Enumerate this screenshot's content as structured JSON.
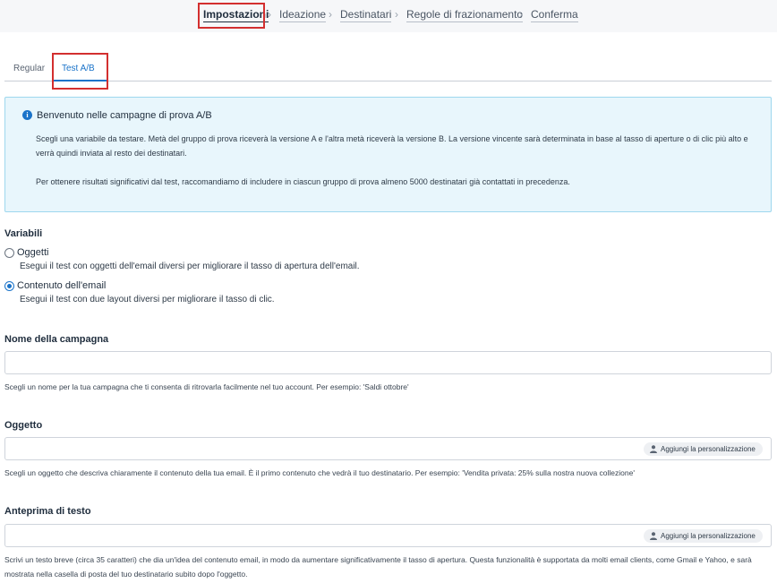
{
  "stepper": {
    "steps": [
      {
        "label": "Impostazioni",
        "active": true
      },
      {
        "label": "Ideazione",
        "active": false
      },
      {
        "label": "Destinatari",
        "active": false
      },
      {
        "label": "Regole di frazionamento",
        "active": false
      },
      {
        "label": "Conferma",
        "active": false
      }
    ]
  },
  "tabs": [
    {
      "label": "Regular",
      "active": false
    },
    {
      "label": "Test A/B",
      "active": true
    }
  ],
  "info": {
    "title": "Benvenuto nelle campagne di prova A/B",
    "paragraph1": "Scegli una variabile da testare. Metà del gruppo di prova riceverà la versione A e l'altra metà riceverà la versione B. La versione vincente sarà determinata in base al tasso di aperture o di clic più alto e verrà quindi inviata al resto dei destinatari.",
    "paragraph2": "Per ottenere risultati significativi dal test, raccomandiamo di includere in ciascun gruppo di prova almeno 5000 destinatari già contattati in precedenza."
  },
  "variables": {
    "title": "Variabili",
    "options": [
      {
        "label": "Oggetti",
        "description": "Esegui il test con oggetti dell'email diversi per migliorare il tasso di apertura dell'email.",
        "checked": false
      },
      {
        "label": "Contenuto dell'email",
        "description": "Esegui il test con due layout diversi per migliorare il tasso di clic.",
        "checked": true
      }
    ]
  },
  "campaign_name": {
    "label": "Nome della campagna",
    "value": "",
    "help": "Scegli un nome per la tua campagna che ti consenta di ritrovarla facilmente nel tuo account. Per esempio: 'Saldi ottobre'"
  },
  "subject": {
    "label": "Oggetto",
    "value": "",
    "button": "Aggiungi la personalizzazione",
    "help": "Scegli un oggetto che descriva chiaramente il contenuto della tua email. È il primo contenuto che vedrà il tuo destinatario. Per esempio: 'Vendita privata: 25% sulla nostra nuova collezione'"
  },
  "preview_text": {
    "label": "Anteprima di testo",
    "value": "",
    "button": "Aggiungi la personalizzazione",
    "help": "Scrivi un testo breve (circa 35 caratteri) che dia un'idea del contenuto email, in modo da aumentare significativamente il tasso di apertura. Questa funzionalità è supportata da molti email clients, come Gmail e Yahoo, e sarà mostrata nella casella di posta del tuo destinatario subito dopo l'oggetto."
  },
  "colors": {
    "accent": "#1a73c9",
    "highlight": "#d32f2f",
    "info_bg": "#e8f6fc",
    "info_border": "#9ed7ee"
  }
}
